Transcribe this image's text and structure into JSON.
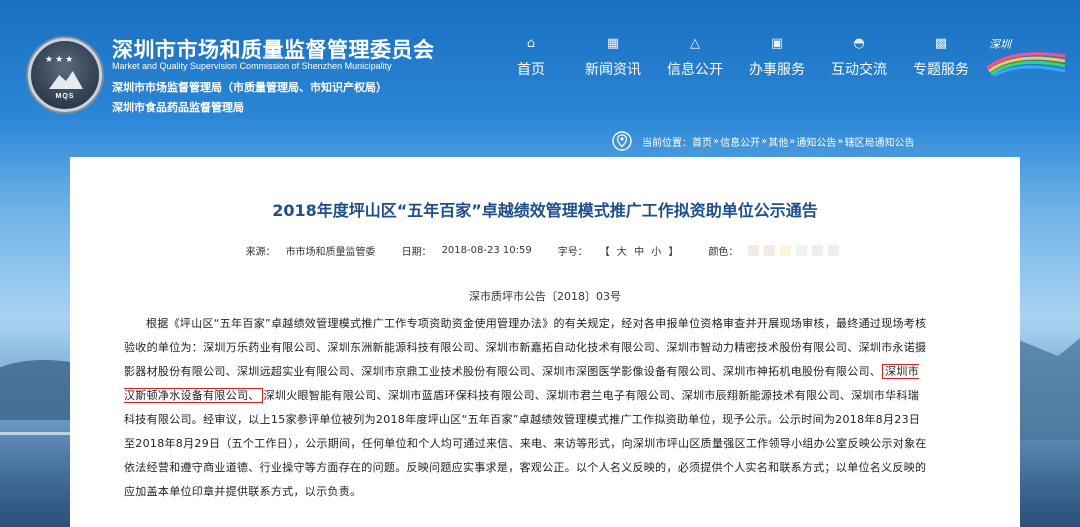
{
  "org": {
    "title_cn": "深圳市市场和质量监督管理委员会",
    "title_en": "Market and Quality Supervision Commission of Shenzhen Municipality",
    "sub1": "深圳市市场监督管理局（市质量管理局、市知识产权局）",
    "sub2": "深圳市食品药品监督管理局",
    "logo_text": "MQS"
  },
  "nav": [
    {
      "label": "首页",
      "icon": "home-icon",
      "glyph": "⌂"
    },
    {
      "label": "新闻资讯",
      "icon": "grid-icon",
      "glyph": "▦"
    },
    {
      "label": "信息公开",
      "icon": "triangle-icon",
      "glyph": "△"
    },
    {
      "label": "办事服务",
      "icon": "briefcase-icon",
      "glyph": "▣"
    },
    {
      "label": "互动交流",
      "icon": "chat-icon",
      "glyph": "◓"
    },
    {
      "label": "专题服务",
      "icon": "squares-icon",
      "glyph": "▩"
    }
  ],
  "brand": {
    "text": "深圳"
  },
  "breadcrumb": {
    "prefix": "当前位置：",
    "items": [
      "首页",
      "信息公开",
      "其他",
      "通知公告",
      "辖区局通知公告"
    ],
    "sep": "»"
  },
  "article": {
    "title": "2018年度坪山区“五年百家”卓越绩效管理模式推广工作拟资助单位公示通告",
    "meta": {
      "source_key": "来源：",
      "source_val": "市市场和质量监管委",
      "date_key": "日期：",
      "date_val": "2018-08-23 10:59",
      "size_key": "字号：",
      "size_open": "【",
      "size_large": "大",
      "size_medium": "中",
      "size_small": "小",
      "size_close": "】",
      "color_key": "颜色：",
      "colors": [
        "#f3ece0",
        "#f6e9ea",
        "#fbf5dc",
        "#eef5ea",
        "#ebeef3",
        "#eeeeee"
      ]
    },
    "doc_number": "深市质坪市公告〔2018〕03号",
    "para_a": "根据《坪山区“五年百家”卓越绩效管理模式推广工作专项资助资金使用管理办法》的有关规定，经对各申报单位资格审查并开展现场审核，最终通过现场考核验收的单位为：深圳万乐药业有限公司、深圳东洲新能源科技有限公司、深圳市新嘉拓自动化技术有限公司、深圳市智动力精密技术股份有限公司、深圳市永诺摄影器材股份有限公司、深圳远超实业有限公司、深圳市京鼎工业技术股份有限公司、深圳市深图医学影像设备有限公司、深圳市神拓机电股份有限公司、",
    "highlight": "深圳市汉斯顿净水设备有限公司、",
    "para_b": "深圳火眼智能有限公司、深圳市蓝盾环保科技有限公司、深圳市君兰电子有限公司、深圳市辰翔新能源技术有限公司、深圳市华科瑞科技有限公司。经审议，以上15家参评单位被列为2018年度坪山区“五年百家”卓越绩效管理模式推广工作拟资助单位，现予公示。公示时间为2018年8月23日至2018年8月29日（五个工作日），公示期间，任何单位和个人均可通过来信、来电、来访等形式，向深圳市坪山区质量强区工作领导小组办公室反映公示对象在依法经营和遵守商业道德、行业操守等方面存在的问题。反映问题应实事求是，客观公正。以个人名义反映的，必须提供个人实名和联系方式；以单位名义反映的应加盖本单位印章并提供联系方式，以示负责。"
  }
}
